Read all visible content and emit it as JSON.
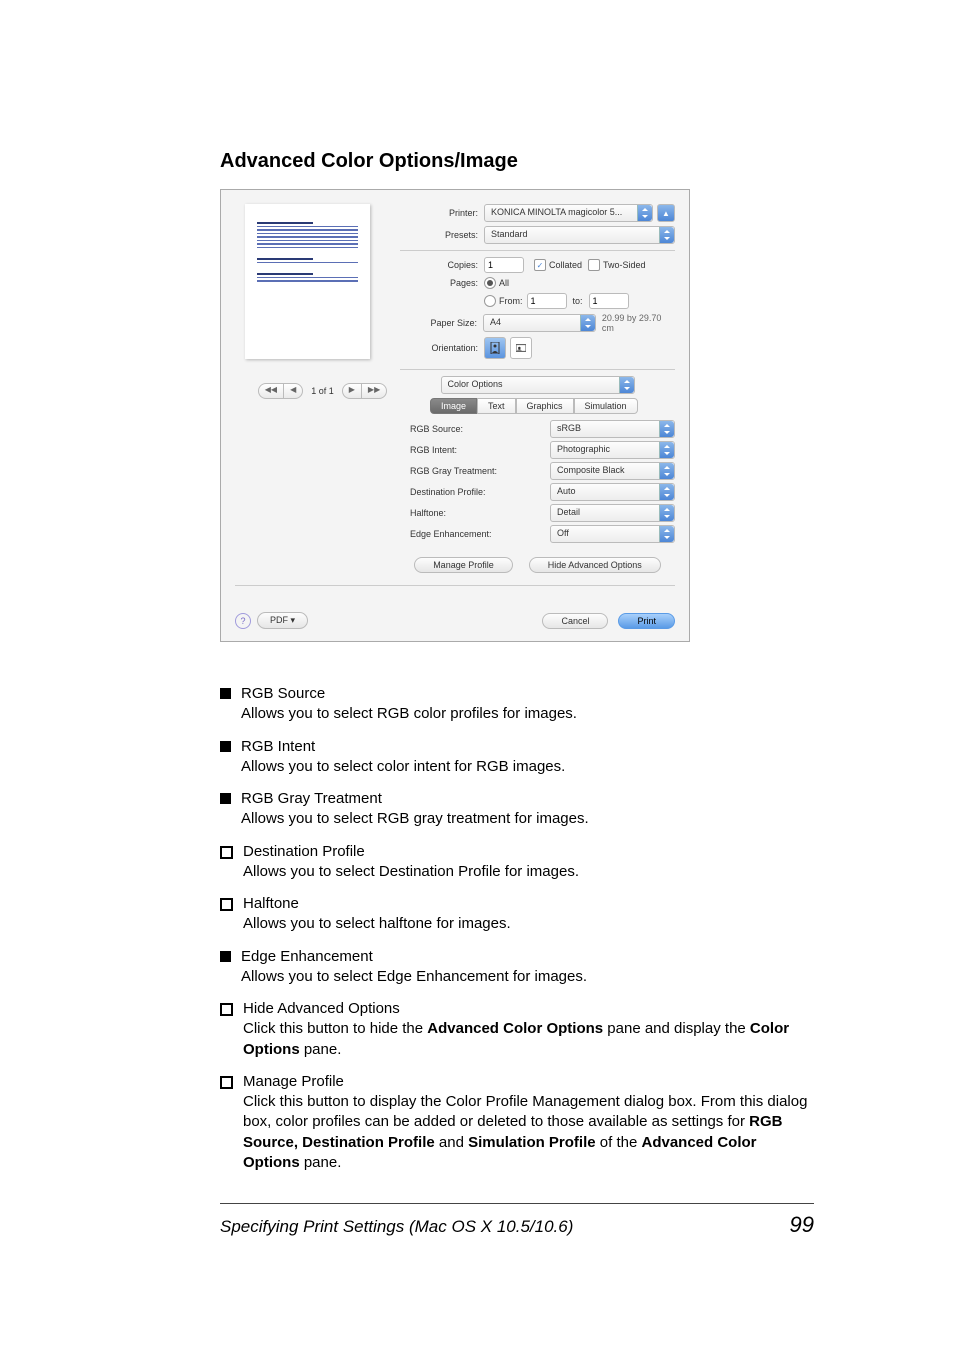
{
  "heading": "Advanced Color Options/Image",
  "dialog": {
    "printer_label": "Printer:",
    "printer_value": "KONICA MINOLTA magicolor 5...",
    "presets_label": "Presets:",
    "presets_value": "Standard",
    "copies_label": "Copies:",
    "copies_value": "1",
    "collated_label": "Collated",
    "twosided_label": "Two-Sided",
    "pages_label": "Pages:",
    "pages_all": "All",
    "pages_from": "From:",
    "pages_from_value": "1",
    "pages_to": "to:",
    "pages_to_value": "1",
    "paper_label": "Paper Size:",
    "paper_value": "A4",
    "paper_dim": "20.99 by 29.70 cm",
    "orient_label": "Orientation:",
    "section_select": "Color Options",
    "tabs": [
      "Image",
      "Text",
      "Graphics",
      "Simulation"
    ],
    "opts": {
      "rgb_source_l": "RGB Source:",
      "rgb_source_v": "sRGB",
      "rgb_intent_l": "RGB Intent:",
      "rgb_intent_v": "Photographic",
      "rgb_gray_l": "RGB Gray Treatment:",
      "rgb_gray_v": "Composite Black",
      "dest_l": "Destination Profile:",
      "dest_v": "Auto",
      "halftone_l": "Halftone:",
      "halftone_v": "Detail",
      "edge_l": "Edge Enhancement:",
      "edge_v": "Off"
    },
    "manage_profile": "Manage Profile",
    "hide_adv": "Hide Advanced Options",
    "pdf_btn": "PDF ▾",
    "cancel": "Cancel",
    "print": "Print",
    "pager": "1 of 1",
    "help": "?"
  },
  "bullets": [
    {
      "t": "RGB Source",
      "b": "Allows you to select RGB color profiles for images."
    },
    {
      "t": "RGB Intent",
      "b": "Allows you to select color intent for RGB images."
    },
    {
      "t": "RGB Gray Treatment",
      "b": "Allows you to select RGB gray treatment for images."
    },
    {
      "t": "Destination Profile",
      "b": "Allows you to select Destination Profile for images."
    },
    {
      "t": "Halftone",
      "b": "Allows you to select halftone for images."
    },
    {
      "t": "Edge Enhancement",
      "b": "Allows you to select Edge Enhancement for images."
    },
    {
      "t": "Hide Advanced Options",
      "b": "Click this button to hide the <b>Advanced Color Options</b> pane and display the <b>Color Options</b> pane.",
      "hollow": false,
      "html": true
    },
    {
      "t": "Manage Profile",
      "b": "Click this button to display the Color Profile Management dialog box. From this dialog box, color profiles can be added or deleted to those available as settings for <b>RGB Source, Destination Profile</b> and <b>Simulation Profile</b> of the <b>Advanced Color Options</b> pane.",
      "html": true
    }
  ],
  "footer": {
    "left": "Specifying Print Settings (Mac OS X 10.5/10.6)",
    "right": "99"
  }
}
